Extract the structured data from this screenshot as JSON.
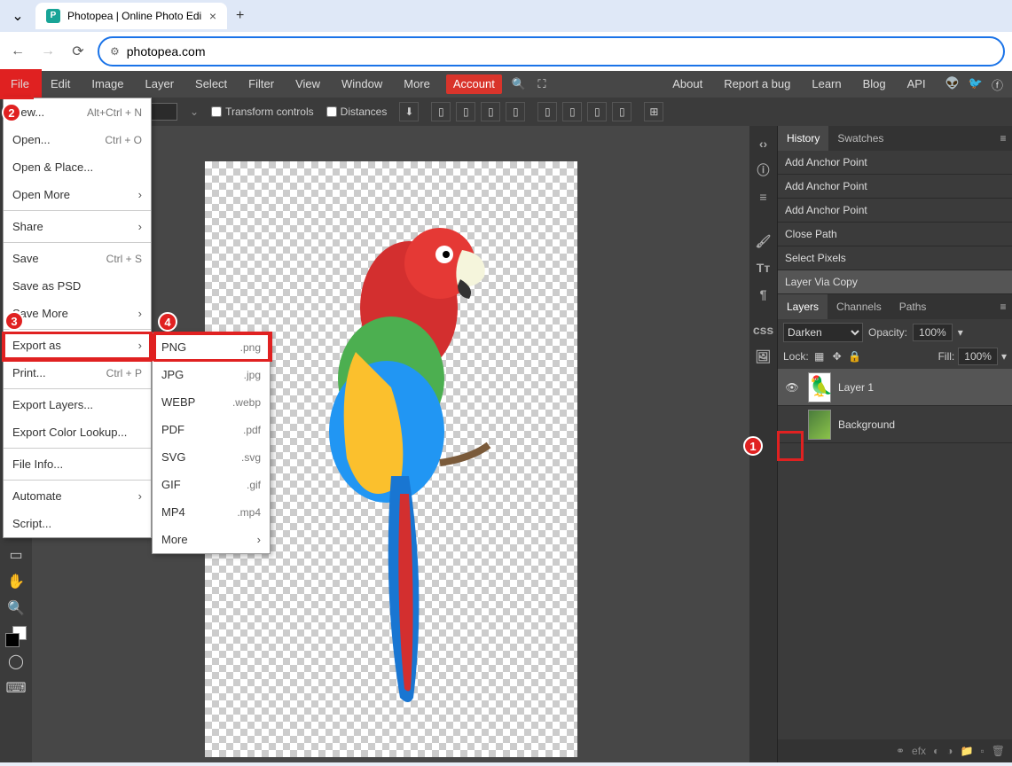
{
  "browser": {
    "tab_title": "Photopea | Online Photo Edi",
    "url": "photopea.com"
  },
  "menubar": {
    "items": [
      "File",
      "Edit",
      "Image",
      "Layer",
      "Select",
      "Filter",
      "View",
      "Window",
      "More"
    ],
    "account": "Account",
    "right": [
      "About",
      "Report a bug",
      "Learn",
      "Blog",
      "API"
    ]
  },
  "toolbar": {
    "transform": "Transform controls",
    "distances": "Distances"
  },
  "file_menu": [
    {
      "label": "New...",
      "shortcut": "Alt+Ctrl + N"
    },
    {
      "label": "Open...",
      "shortcut": "Ctrl + O"
    },
    {
      "label": "Open & Place..."
    },
    {
      "label": "Open More",
      "chev": true
    },
    {
      "sep": true
    },
    {
      "label": "Share",
      "chev": true
    },
    {
      "sep": true
    },
    {
      "label": "Save",
      "shortcut": "Ctrl + S"
    },
    {
      "label": "Save as PSD"
    },
    {
      "label": "Save More",
      "chev": true
    },
    {
      "sep": true
    },
    {
      "label": "Export as",
      "chev": true,
      "hl": true
    },
    {
      "label": "Print...",
      "shortcut": "Ctrl + P"
    },
    {
      "sep": true
    },
    {
      "label": "Export Layers..."
    },
    {
      "label": "Export Color Lookup..."
    },
    {
      "sep": true
    },
    {
      "label": "File Info..."
    },
    {
      "sep": true
    },
    {
      "label": "Automate",
      "chev": true
    },
    {
      "label": "Script..."
    }
  ],
  "export_menu": [
    {
      "label": "PNG",
      "ext": ".png",
      "hl": true
    },
    {
      "label": "JPG",
      "ext": ".jpg"
    },
    {
      "label": "WEBP",
      "ext": ".webp"
    },
    {
      "label": "PDF",
      "ext": ".pdf"
    },
    {
      "label": "SVG",
      "ext": ".svg"
    },
    {
      "label": "GIF",
      "ext": ".gif"
    },
    {
      "label": "MP4",
      "ext": ".mp4"
    },
    {
      "label": "More",
      "chev": true
    }
  ],
  "history_panel": {
    "tabs": [
      "History",
      "Swatches"
    ],
    "items": [
      "Add Anchor Point",
      "Add Anchor Point",
      "Add Anchor Point",
      "Close Path",
      "Select Pixels",
      "Layer Via Copy"
    ]
  },
  "layers_panel": {
    "tabs": [
      "Layers",
      "Channels",
      "Paths"
    ],
    "blend": "Darken",
    "opacity_label": "Opacity:",
    "opacity": "100%",
    "lock_label": "Lock:",
    "fill_label": "Fill:",
    "fill": "100%",
    "layers": [
      {
        "name": "Layer 1",
        "visible": true
      },
      {
        "name": "Background",
        "visible": false
      }
    ]
  },
  "steps": {
    "1": "1",
    "2": "2",
    "3": "3",
    "4": "4",
    "5": "1"
  }
}
